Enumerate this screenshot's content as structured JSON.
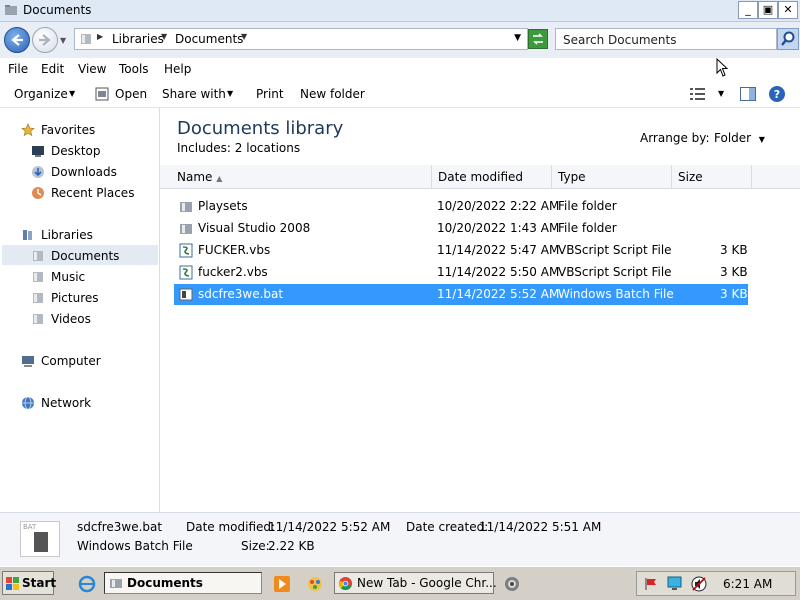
{
  "window": {
    "title": "Documents",
    "controls": {
      "minimize": "_",
      "maximize": "▣",
      "close": "✕"
    }
  },
  "address": {
    "crumbs": [
      "Libraries",
      "Documents"
    ],
    "search_placeholder": "Search Documents"
  },
  "menu": [
    "File",
    "Edit",
    "View",
    "Tools",
    "Help"
  ],
  "toolbar": {
    "organize": "Organize",
    "open": "Open",
    "share_with": "Share with",
    "print": "Print",
    "new_folder": "New folder"
  },
  "nav": {
    "favorites": "Favorites",
    "desktop": "Desktop",
    "downloads": "Downloads",
    "recent_places": "Recent Places",
    "libraries": "Libraries",
    "documents": "Documents",
    "music": "Music",
    "pictures": "Pictures",
    "videos": "Videos",
    "computer": "Computer",
    "network": "Network"
  },
  "library": {
    "title": "Documents library",
    "includes": "Includes:  2 locations",
    "arrange_label": "Arrange by:",
    "arrange_value": "Folder"
  },
  "columns": {
    "name": "Name",
    "date": "Date modified",
    "type": "Type",
    "size": "Size"
  },
  "files": [
    {
      "name": "Playsets",
      "date": "10/20/2022 2:22 AM",
      "type": "File folder",
      "size": "",
      "icon": "folder-icon"
    },
    {
      "name": "Visual Studio 2008",
      "date": "10/20/2022 1:43 AM",
      "type": "File folder",
      "size": "",
      "icon": "folder-icon"
    },
    {
      "name": "FUCKER.vbs",
      "date": "11/14/2022 5:47 AM",
      "type": "VBScript Script File",
      "size": "3 KB",
      "icon": "vbscript-icon"
    },
    {
      "name": "fucker2.vbs",
      "date": "11/14/2022 5:50 AM",
      "type": "VBScript Script File",
      "size": "3 KB",
      "icon": "vbscript-icon"
    },
    {
      "name": "sdcfre3we.bat",
      "date": "11/14/2022 5:52 AM",
      "type": "Windows Batch File",
      "size": "3 KB",
      "icon": "batch-file-icon",
      "selected": true
    }
  ],
  "details": {
    "icon_label": "BAT",
    "name": "sdcfre3we.bat",
    "type": "Windows Batch File",
    "modified_label": "Date modified:",
    "modified_value": "11/14/2022 5:52 AM",
    "created_label": "Date created:",
    "created_value": "11/14/2022 5:51 AM",
    "size_label": "Size:",
    "size_value": "2.22 KB"
  },
  "taskbar": {
    "start": "Start",
    "tasks": [
      "Documents",
      "New Tab - Google Chr..."
    ],
    "clock": "6:21 AM"
  },
  "colors": {
    "selection": "#3399ff",
    "title_text": "#1e395b",
    "taskbar": "#d4d0c8"
  }
}
